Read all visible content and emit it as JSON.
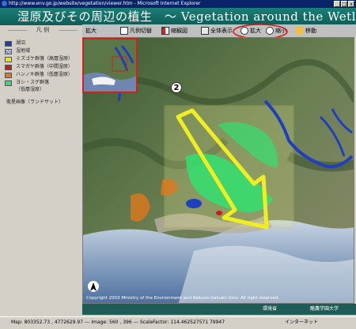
{
  "window": {
    "title": "http://www.env.go.jp/website/vegetation/viewer.htm - Microsoft Internet Explorer"
  },
  "header": {
    "title": "湿原及びその周辺の植生　～ Vegetation around the Wetland ～"
  },
  "legend": {
    "title": "凡 例",
    "items": [
      {
        "label": "湖沼",
        "color": "#1f3fbf"
      },
      {
        "label": "湿地域",
        "color": "#b9c8e8"
      },
      {
        "label": "ミズゴケ群落（高層湿原）",
        "color": "#e8e800"
      },
      {
        "label": "スマガヤ群落（中間湿原）",
        "color": "#d01a1a"
      },
      {
        "label": "ハンノキ群落（低層湿原）",
        "color": "#e0781a"
      },
      {
        "label": "ヨシ・スゲ群落",
        "color": "#33e070"
      }
    ],
    "sub_label": "（低層湿原）",
    "satellite_label": "衛星画像（ランドサット）"
  },
  "toolbar": {
    "zoom_label": "拡大",
    "legend_toggle": "凡例切替",
    "overview": "縮観図",
    "full_view": "全体表示",
    "zoom_in": "拡大",
    "zoom_out": "縮小",
    "move": "移動"
  },
  "map": {
    "copyright": "Copyright 2003 Ministry of the Environment and Rakuno Gakuen Univ. All right reserved."
  },
  "callouts": {
    "one": "1",
    "two": "2"
  },
  "footer": {
    "ministry": "環境省",
    "university": "酪農学園大学"
  },
  "status": {
    "map_info": "Map: 803352.73 , 4772629.97 --- Image: 560 , 396 --- ScaleFactor: 114.462527571 79947",
    "zone": "インターネット"
  }
}
